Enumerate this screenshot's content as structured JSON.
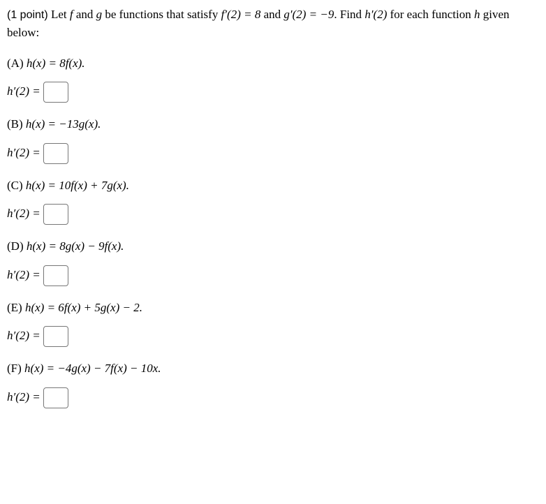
{
  "intro": {
    "points_label": "(1 point)",
    "text_before": " Let ",
    "f": "f",
    "and": " and ",
    "g": "g",
    "text_mid": " be functions that satisfy ",
    "fprime": "f′(2) = 8",
    "text_and2": " and ",
    "gprime": "g′(2) = −9",
    "text_after": ". Find ",
    "hprime": "h′(2)",
    "text_end": " for each function ",
    "h": "h",
    "text_final": " given below:"
  },
  "parts": {
    "A": {
      "label": "(A) ",
      "expr": "h(x) = 8f(x)."
    },
    "B": {
      "label": "(B) ",
      "expr": "h(x) = −13g(x)."
    },
    "C": {
      "label": "(C) ",
      "expr": "h(x) = 10f(x) + 7g(x)."
    },
    "D": {
      "label": "(D) ",
      "expr": "h(x) = 8g(x) − 9f(x)."
    },
    "E": {
      "label": "(E) ",
      "expr": "h(x) = 6f(x) + 5g(x) − 2."
    },
    "F": {
      "label": "(F) ",
      "expr": "h(x) = −4g(x) − 7f(x) − 10x."
    }
  },
  "answer_prefix": "h′(2) ="
}
